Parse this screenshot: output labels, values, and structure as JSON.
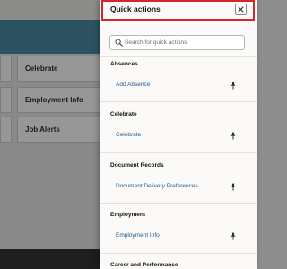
{
  "background": {
    "tiles": [
      "Celebrate",
      "Employment Info",
      "Job Alerts"
    ]
  },
  "panel": {
    "title": "Quick actions",
    "close_label": "×",
    "search": {
      "placeholder": "Search for quick actions",
      "value": ""
    },
    "sections": [
      {
        "title": "Absences",
        "actions": [
          {
            "label": "Add Absence",
            "pinned": true
          }
        ]
      },
      {
        "title": "Celebrate",
        "actions": [
          {
            "label": "Celebrate",
            "pinned": true
          }
        ]
      },
      {
        "title": "Document Records",
        "actions": [
          {
            "label": "Document Delivery Preferences",
            "pinned": true
          }
        ]
      },
      {
        "title": "Employment",
        "actions": [
          {
            "label": "Employment Info",
            "pinned": true
          }
        ]
      },
      {
        "title": "Career and Performance",
        "actions": []
      }
    ]
  },
  "colors": {
    "link": "#1e5a8c",
    "highlight_border": "#d6262b",
    "banner": "#2c5262"
  }
}
